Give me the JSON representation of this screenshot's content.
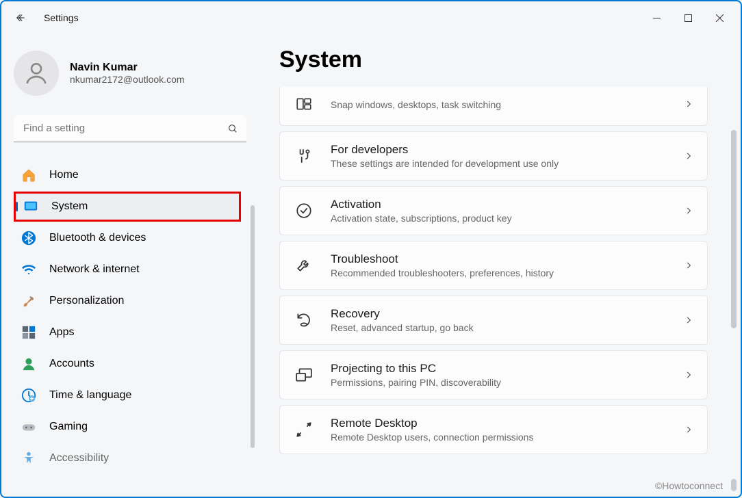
{
  "window": {
    "title": "Settings"
  },
  "user": {
    "name": "Navin Kumar",
    "email": "nkumar2172@outlook.com"
  },
  "search": {
    "placeholder": "Find a setting"
  },
  "sidebar": {
    "items": [
      {
        "label": "Home",
        "icon": "home"
      },
      {
        "label": "System",
        "icon": "system",
        "active": true,
        "highlighted": true
      },
      {
        "label": "Bluetooth & devices",
        "icon": "bluetooth"
      },
      {
        "label": "Network & internet",
        "icon": "wifi"
      },
      {
        "label": "Personalization",
        "icon": "brush"
      },
      {
        "label": "Apps",
        "icon": "apps"
      },
      {
        "label": "Accounts",
        "icon": "account"
      },
      {
        "label": "Time & language",
        "icon": "time"
      },
      {
        "label": "Gaming",
        "icon": "gaming"
      },
      {
        "label": "Accessibility",
        "icon": "accessibility"
      }
    ]
  },
  "main": {
    "title": "System",
    "cards": [
      {
        "title": "",
        "subtitle": "Snap windows, desktops, task switching",
        "icon": "multitask",
        "partialTop": true
      },
      {
        "title": "For developers",
        "subtitle": "These settings are intended for development use only",
        "icon": "developer"
      },
      {
        "title": "Activation",
        "subtitle": "Activation state, subscriptions, product key",
        "icon": "activation"
      },
      {
        "title": "Troubleshoot",
        "subtitle": "Recommended troubleshooters, preferences, history",
        "icon": "troubleshoot"
      },
      {
        "title": "Recovery",
        "subtitle": "Reset, advanced startup, go back",
        "icon": "recovery",
        "highlighted": true
      },
      {
        "title": "Projecting to this PC",
        "subtitle": "Permissions, pairing PIN, discoverability",
        "icon": "projecting"
      },
      {
        "title": "Remote Desktop",
        "subtitle": "Remote Desktop users, connection permissions",
        "icon": "remote"
      }
    ]
  },
  "watermark": "©Howtoconnect"
}
